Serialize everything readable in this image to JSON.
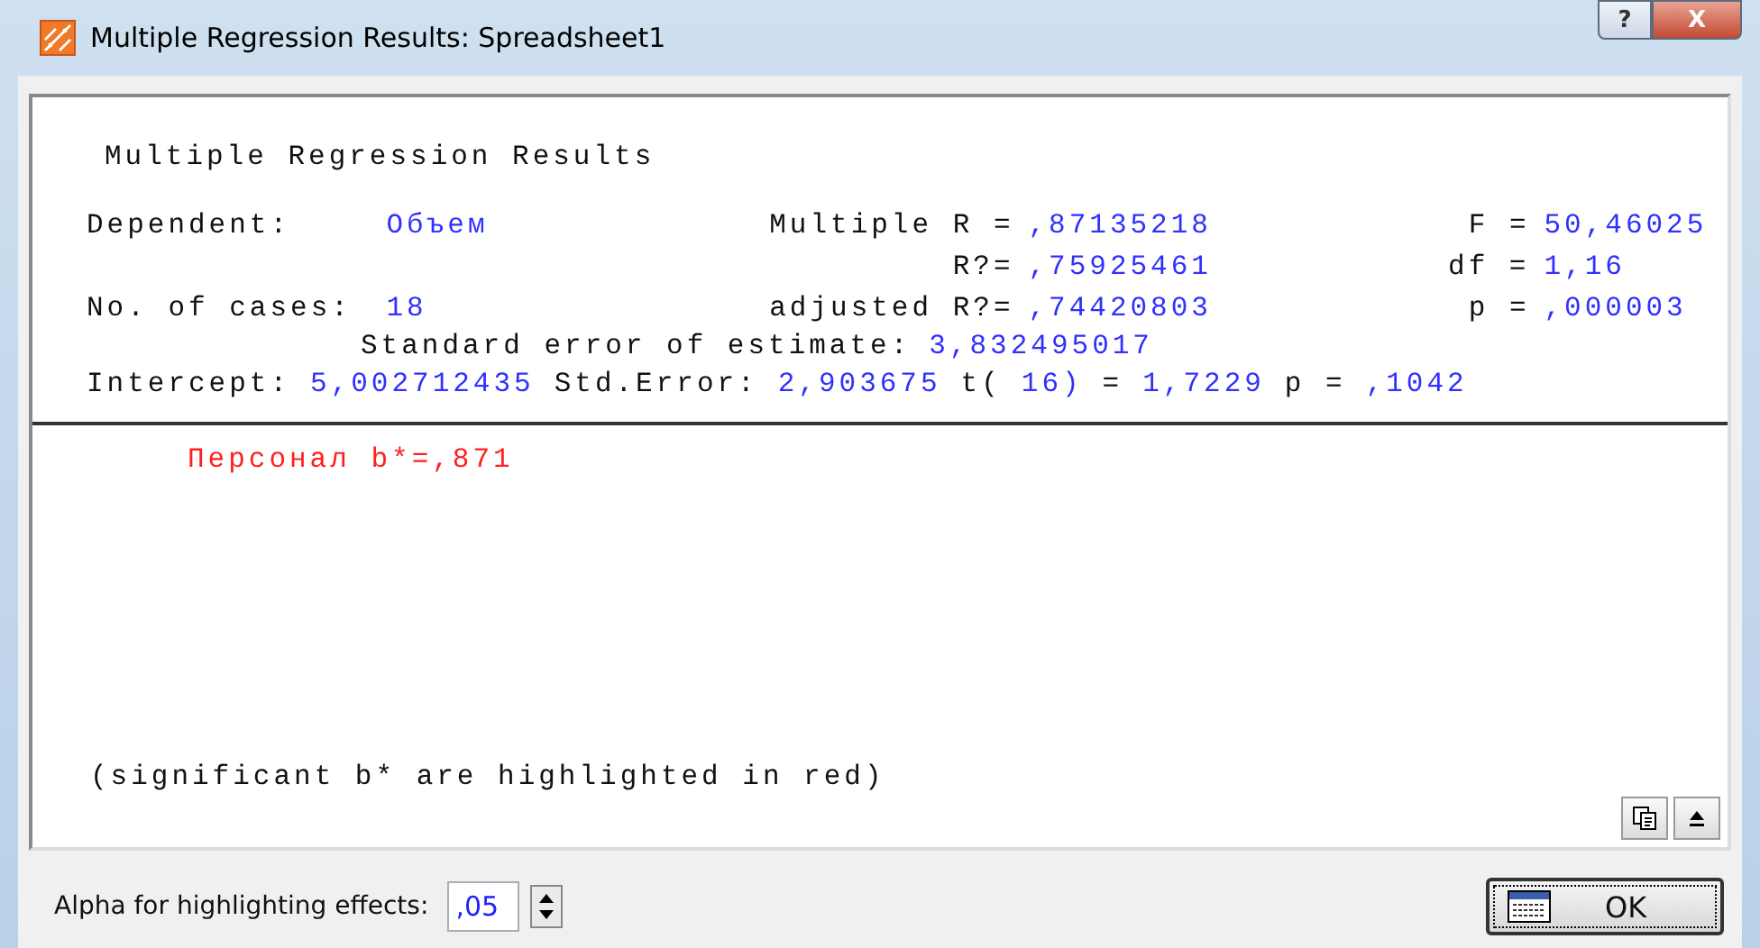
{
  "window": {
    "title": "Multiple Regression Results: Spreadsheet1",
    "buttons": [
      {
        "kind": "help",
        "label": "?"
      },
      {
        "kind": "close",
        "label": "X"
      }
    ]
  },
  "report": {
    "heading": "Multiple Regression Results",
    "summary": [
      {
        "left_label": "Dependent:",
        "left_value": "Объем",
        "mid_label": "Multiple R =",
        "mid_value": ",87135218",
        "right_label": "F =",
        "right_value": "50,46025"
      },
      {
        "mid_label": "R?=",
        "mid_value": ",75925461",
        "right_label": "df =",
        "right_value": "1,16"
      },
      {
        "left_label": "No. of cases:",
        "left_value": "18",
        "mid_label": "adjusted R?=",
        "mid_value": ",74420803",
        "right_label": "p =",
        "right_value": ",000003"
      }
    ],
    "std_error": {
      "label": "Standard error of estimate:",
      "value": "3,832495017"
    },
    "intercept": [
      {
        "kind": "label",
        "text": "Intercept:"
      },
      {
        "kind": "value",
        "text": "5,002712435"
      },
      {
        "kind": "label",
        "text": "Std.Error:"
      },
      {
        "kind": "value",
        "text": "2,903675"
      },
      {
        "kind": "label",
        "text": "t("
      },
      {
        "kind": "value",
        "text": "16)"
      },
      {
        "kind": "label",
        "text": "="
      },
      {
        "kind": "value",
        "text": "1,7229"
      },
      {
        "kind": "label",
        "text": "p ="
      },
      {
        "kind": "value",
        "text": ",1042"
      }
    ],
    "effects": [
      {
        "text": "Персонал b*=,871",
        "significant": true
      }
    ],
    "note": "(significant b* are highlighted in red)"
  },
  "alpha": {
    "label": "Alpha for highlighting effects:",
    "value": ",05"
  },
  "ok_button": "OK"
}
